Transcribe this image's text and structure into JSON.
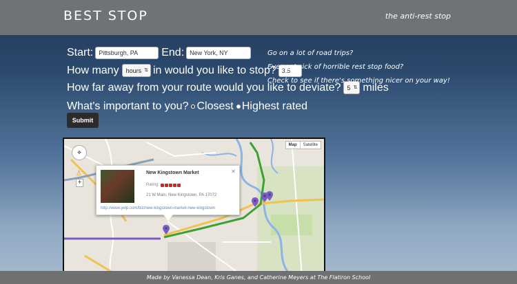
{
  "header": {
    "brand": "BEST STOP",
    "tagline": "the anti-rest stop"
  },
  "form": {
    "start_label": "Start:",
    "start_value": "Pittsburgh, PA",
    "end_label": "End:",
    "end_value": "New York, NY",
    "how_many_label": "How many",
    "unit_select": "hours",
    "stop_label": "in would you like to stop?",
    "stop_value": "3.5",
    "deviate_label": "How far away from your route would you like to deviate?",
    "deviate_select": "5",
    "deviate_unit": "miles",
    "importance_label": "What's important to you?",
    "option_closest": "Closest",
    "option_highest": "Highest rated",
    "selected_option": "Closest",
    "submit_label": "Submit"
  },
  "pitch": {
    "line1": "Go on a lot of road trips?",
    "line2": "Ever get sick of horrible rest stop food?",
    "line3": "Check to see if there's something nicer on your way!"
  },
  "map": {
    "type_map": "Map",
    "type_satellite": "Satellite",
    "zoom_in": "+",
    "info": {
      "title": "New Kingstown Market",
      "rating_label": "Rating:",
      "rating": 5,
      "address": "21 W Main, New Kingstown, PA 17072",
      "link": "http://www.yelp.com/biz/new-kingstown-market-new-kingstown"
    },
    "colors": {
      "route": "#3aa132",
      "road_major": "#f2c14e",
      "road_purple": "#7a5cc2",
      "pin": "#7a5cc2"
    }
  },
  "footer": {
    "text": "Made by Vanessa Dean, Kris Ganes, and Catherine Meyers at The Flatiron School"
  }
}
